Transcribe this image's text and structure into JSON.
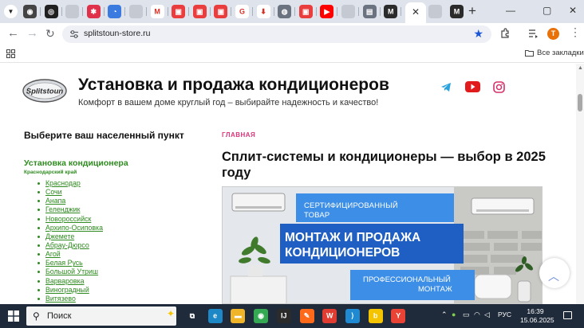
{
  "browser": {
    "new_tab_glyph": "+",
    "close_tab_glyph": "✕",
    "window": {
      "minimize": "—",
      "maximize": "▢",
      "close": "✕"
    },
    "tabs": [
      {
        "icon": "chrome-icon",
        "color": "#444444",
        "glyph": "◉"
      },
      {
        "icon": "openai-icon",
        "color": "#202020",
        "glyph": "◎"
      },
      {
        "icon": "generic-site-icon",
        "color": "#c4c9d2",
        "glyph": ""
      },
      {
        "icon": "red-app-icon",
        "color": "#e0314b",
        "glyph": "✱"
      },
      {
        "icon": "blue-app-icon",
        "color": "#3b7be0",
        "glyph": "◔"
      },
      {
        "icon": "generic-site-icon",
        "color": "#c4c9d2",
        "glyph": ""
      },
      {
        "icon": "gmail-icon",
        "color": "#ffffff",
        "glyph": "M"
      },
      {
        "icon": "red-square-icon",
        "color": "#ea3d3d",
        "glyph": "▣"
      },
      {
        "icon": "red-square-icon",
        "color": "#ea3d3d",
        "glyph": "▣"
      },
      {
        "icon": "red-square-icon",
        "color": "#ea3d3d",
        "glyph": "▣"
      },
      {
        "icon": "google-icon",
        "color": "#ffffff",
        "glyph": "G"
      },
      {
        "icon": "download-icon",
        "color": "#ffffff",
        "glyph": "⬇"
      },
      {
        "icon": "globe-icon",
        "color": "#6b7280",
        "glyph": "◍"
      },
      {
        "icon": "red-square-icon",
        "color": "#ea3d3d",
        "glyph": "▣"
      },
      {
        "icon": "youtube-icon",
        "color": "#ff0000",
        "glyph": "▶"
      },
      {
        "icon": "generic-site-icon",
        "color": "#c4c9d2",
        "glyph": ""
      },
      {
        "icon": "printer-icon",
        "color": "#6b7280",
        "glyph": "▤"
      },
      {
        "icon": "m-logo-icon",
        "color": "#2b2b2b",
        "glyph": "M"
      }
    ],
    "after_active_tabs": [
      {
        "icon": "generic-site-icon",
        "color": "#c4c9d2",
        "glyph": ""
      },
      {
        "icon": "m-logo-icon",
        "color": "#2b2b2b",
        "glyph": "M"
      }
    ],
    "url": "splitstoun-store.ru",
    "profile_initial": "T",
    "all_bookmarks": "Все закладки"
  },
  "site": {
    "logo_text": "Splitstoun",
    "title": "Установка и продажа кондиционеров",
    "tagline": "Комфорт в вашем доме круглый год – выбирайте надежность и качество!"
  },
  "sidebar": {
    "title": "Выберите ваш населенный пункт",
    "section": "Установка кондиционера",
    "region": "Краснодарский край",
    "cities": [
      "Краснодар",
      "Сочи",
      "Анапа",
      "Геленджик",
      "Новороссийск",
      "Архипо-Осиповка",
      "Джемете",
      "Абрау-Дюрсо",
      "Агой",
      "Белая Русь",
      "Большой Утриш",
      "Варваровка",
      "Виноградный",
      "Витязево"
    ]
  },
  "article": {
    "breadcrumb": "ГЛАВНАЯ",
    "title": "Сплит-системы и кондиционеры — выбор в 2025 году",
    "banner": {
      "line1": "СЕРТИФИЦИРОВАННЫЙ",
      "line2": "ТОВАР",
      "main1": "МОНТАЖ И ПРОДАЖА",
      "main2": "КОНДИЦИОНЕРОВ",
      "line3": "ПРОФЕССИОНАЛЬНЫЙ",
      "line4": "МОНТАЖ"
    }
  },
  "scroll_top_glyph": "︿",
  "taskbar": {
    "search_label": "Поиск",
    "language": "РУС",
    "time": "16:39",
    "date": "15.06.2025",
    "apps": [
      {
        "name": "task-view-icon",
        "color": "#1f2a3a",
        "glyph": "⧉"
      },
      {
        "name": "edge-icon",
        "color": "#1e88c7",
        "glyph": "e"
      },
      {
        "name": "file-explorer-icon",
        "color": "#f0b429",
        "glyph": "▬"
      },
      {
        "name": "chrome-icon",
        "color": "#34a853",
        "glyph": "◉"
      },
      {
        "name": "jetbrains-icon",
        "color": "#2b2b2b",
        "glyph": "IJ"
      },
      {
        "name": "orange-app-icon",
        "color": "#ff6a1a",
        "glyph": "✎"
      },
      {
        "name": "wps-icon",
        "color": "#e03c31",
        "glyph": "W"
      },
      {
        "name": "vscode-icon",
        "color": "#1f8ad2",
        "glyph": "⟩"
      },
      {
        "name": "yellow-app-icon",
        "color": "#f5c400",
        "glyph": "b"
      },
      {
        "name": "yandex-browser-icon",
        "color": "#e94335",
        "glyph": "Y"
      }
    ]
  }
}
